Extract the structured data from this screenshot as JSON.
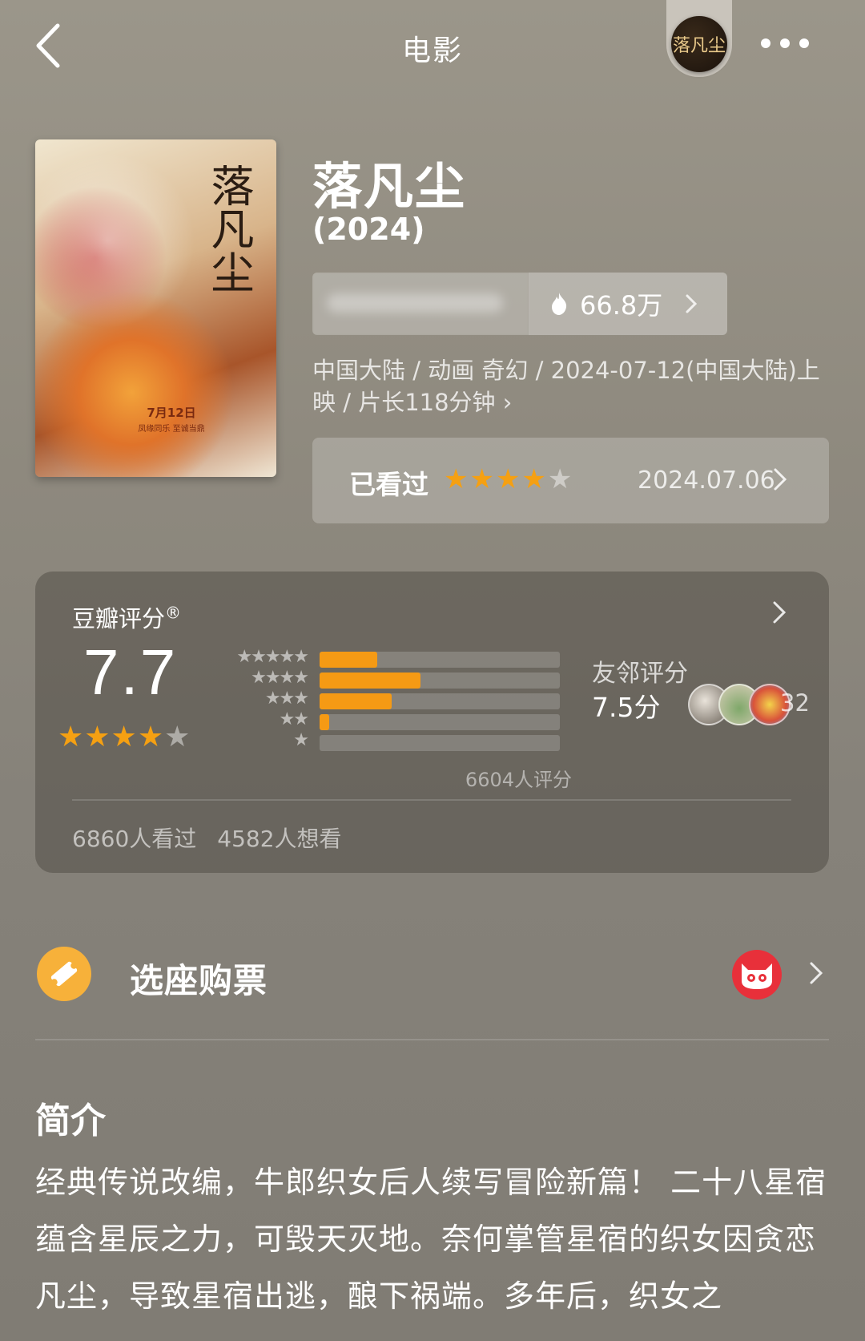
{
  "nav": {
    "title": "电影",
    "back_icon": "chevron-left-icon",
    "more_icon": "more-dots-icon",
    "mini_poster_text": "落凡尘"
  },
  "movie": {
    "title": "落凡尘",
    "year": "(2024)",
    "poster_title": "落凡尘",
    "poster_date": "7月12日",
    "poster_tagline": "凤缘同乐 至诚当鼎",
    "heat": "66.8万",
    "meta": "中国大陆 / 动画 奇幻 / 2024-07-12(中国大陆)上映 / 片长118分钟 ›"
  },
  "watched": {
    "label": "已看过",
    "stars": 4,
    "max_stars": 5,
    "date": "2024.07.06"
  },
  "rating": {
    "label": "豆瓣评分",
    "mark": "®",
    "score": "7.7",
    "stars": 4,
    "distribution": [
      {
        "stars": "★★★★★",
        "percent": 24
      },
      {
        "stars": "★★★★",
        "percent": 42
      },
      {
        "stars": "★★★",
        "percent": 30
      },
      {
        "stars": "★★",
        "percent": 4
      },
      {
        "stars": "★",
        "percent": 0
      }
    ],
    "total": "6604人评分",
    "friend_label": "友邻评分",
    "friend_score": "7.5分",
    "friend_count": "32",
    "watched_count": "6860人看过",
    "want_count": "4582人想看"
  },
  "ticket": {
    "label": "选座购票",
    "icon": "ticket-icon",
    "provider_icon": "cat-logo-icon"
  },
  "intro": {
    "title": "简介",
    "text": "经典传说改编，牛郎织女后人续写冒险新篇！ 二十八星宿蕴含星辰之力，可毁天灭地。奈何掌管星宿的织女因贪恋凡尘，导致星宿出逃，酿下祸端。多年后，织女之"
  },
  "colors": {
    "accent": "#f59a14",
    "star_off": "#c9c5bc",
    "ticket": "#f7b13a",
    "cat": "#e8303a"
  }
}
